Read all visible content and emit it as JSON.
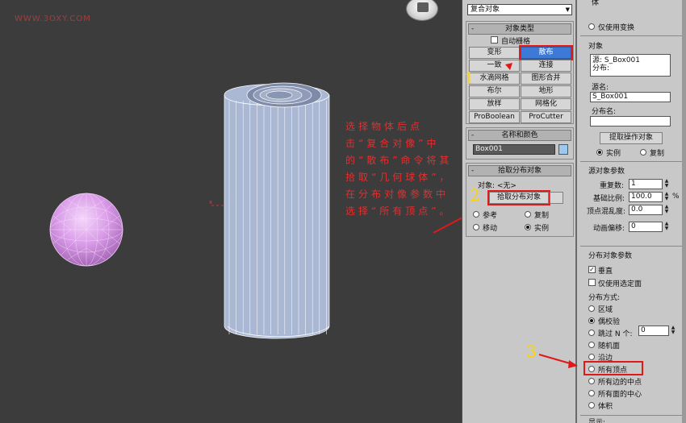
{
  "watermark": "WWW.3OXY.COM",
  "annotations": {
    "instruction": "选择物体后点击“复合对像”中的“散布”命令将其拾取“几何球体”，在分布对像参数中选择“所有顶点”。",
    "num1": "1",
    "num2": "2",
    "num3": "3"
  },
  "colors": {
    "highlight": "#e01818",
    "active_button": "#3d7ad8",
    "sphere": "#d99be8",
    "annotation_text": "#e03030",
    "step_number": "#ffd400"
  },
  "mid_panel": {
    "dropdown_value": "复合对象",
    "object_type": {
      "title": "对象类型",
      "auto_grid": "自动栅格",
      "buttons": [
        "变形",
        "散布",
        "一致",
        "连接",
        "水滴网格",
        "图形合并",
        "布尔",
        "地形",
        "放样",
        "网格化",
        "ProBoolean",
        "ProCutter"
      ]
    },
    "name_color": {
      "title": "名称和颜色",
      "name_value": "Box001"
    },
    "pick_distribution": {
      "title": "拾取分布对象",
      "object_label": "对象: <无>",
      "pick_button": "拾取分布对象",
      "radios": [
        "参考",
        "复制",
        "移动",
        "实例"
      ]
    }
  },
  "right_panel": {
    "top_partial": "体",
    "only_transform": "仅使用变换",
    "objects": {
      "title": "对象",
      "list": [
        "源: S_Box001",
        "分布:"
      ],
      "source_name_label": "源名:",
      "source_name_value": "S_Box001",
      "dist_name_label": "分布名:",
      "dist_name_value": "",
      "extract_button": "提取操作对象",
      "radio_instance": "实例",
      "radio_copy": "复制"
    },
    "source_params": {
      "title": "源对象参数",
      "duplicates_label": "重复数:",
      "duplicates_value": "1",
      "base_scale_label": "基础比例:",
      "base_scale_value": "100.0",
      "percent": "%",
      "vertex_chaos_label": "顶点混乱度:",
      "vertex_chaos_value": "0.0",
      "anim_offset_label": "动画偏移:",
      "anim_offset_value": "0"
    },
    "dist_params": {
      "title": "分布对象参数",
      "perpendicular": "垂直",
      "only_selected": "仅使用选定面",
      "method_label": "分布方式:",
      "methods": [
        "区域",
        "偶校验",
        "跳过 N 个:",
        "随机面",
        "沿边",
        "所有顶点",
        "所有边的中点",
        "所有面的中心",
        "体积"
      ],
      "skip_value": "0"
    },
    "display_partial": "显示:"
  }
}
